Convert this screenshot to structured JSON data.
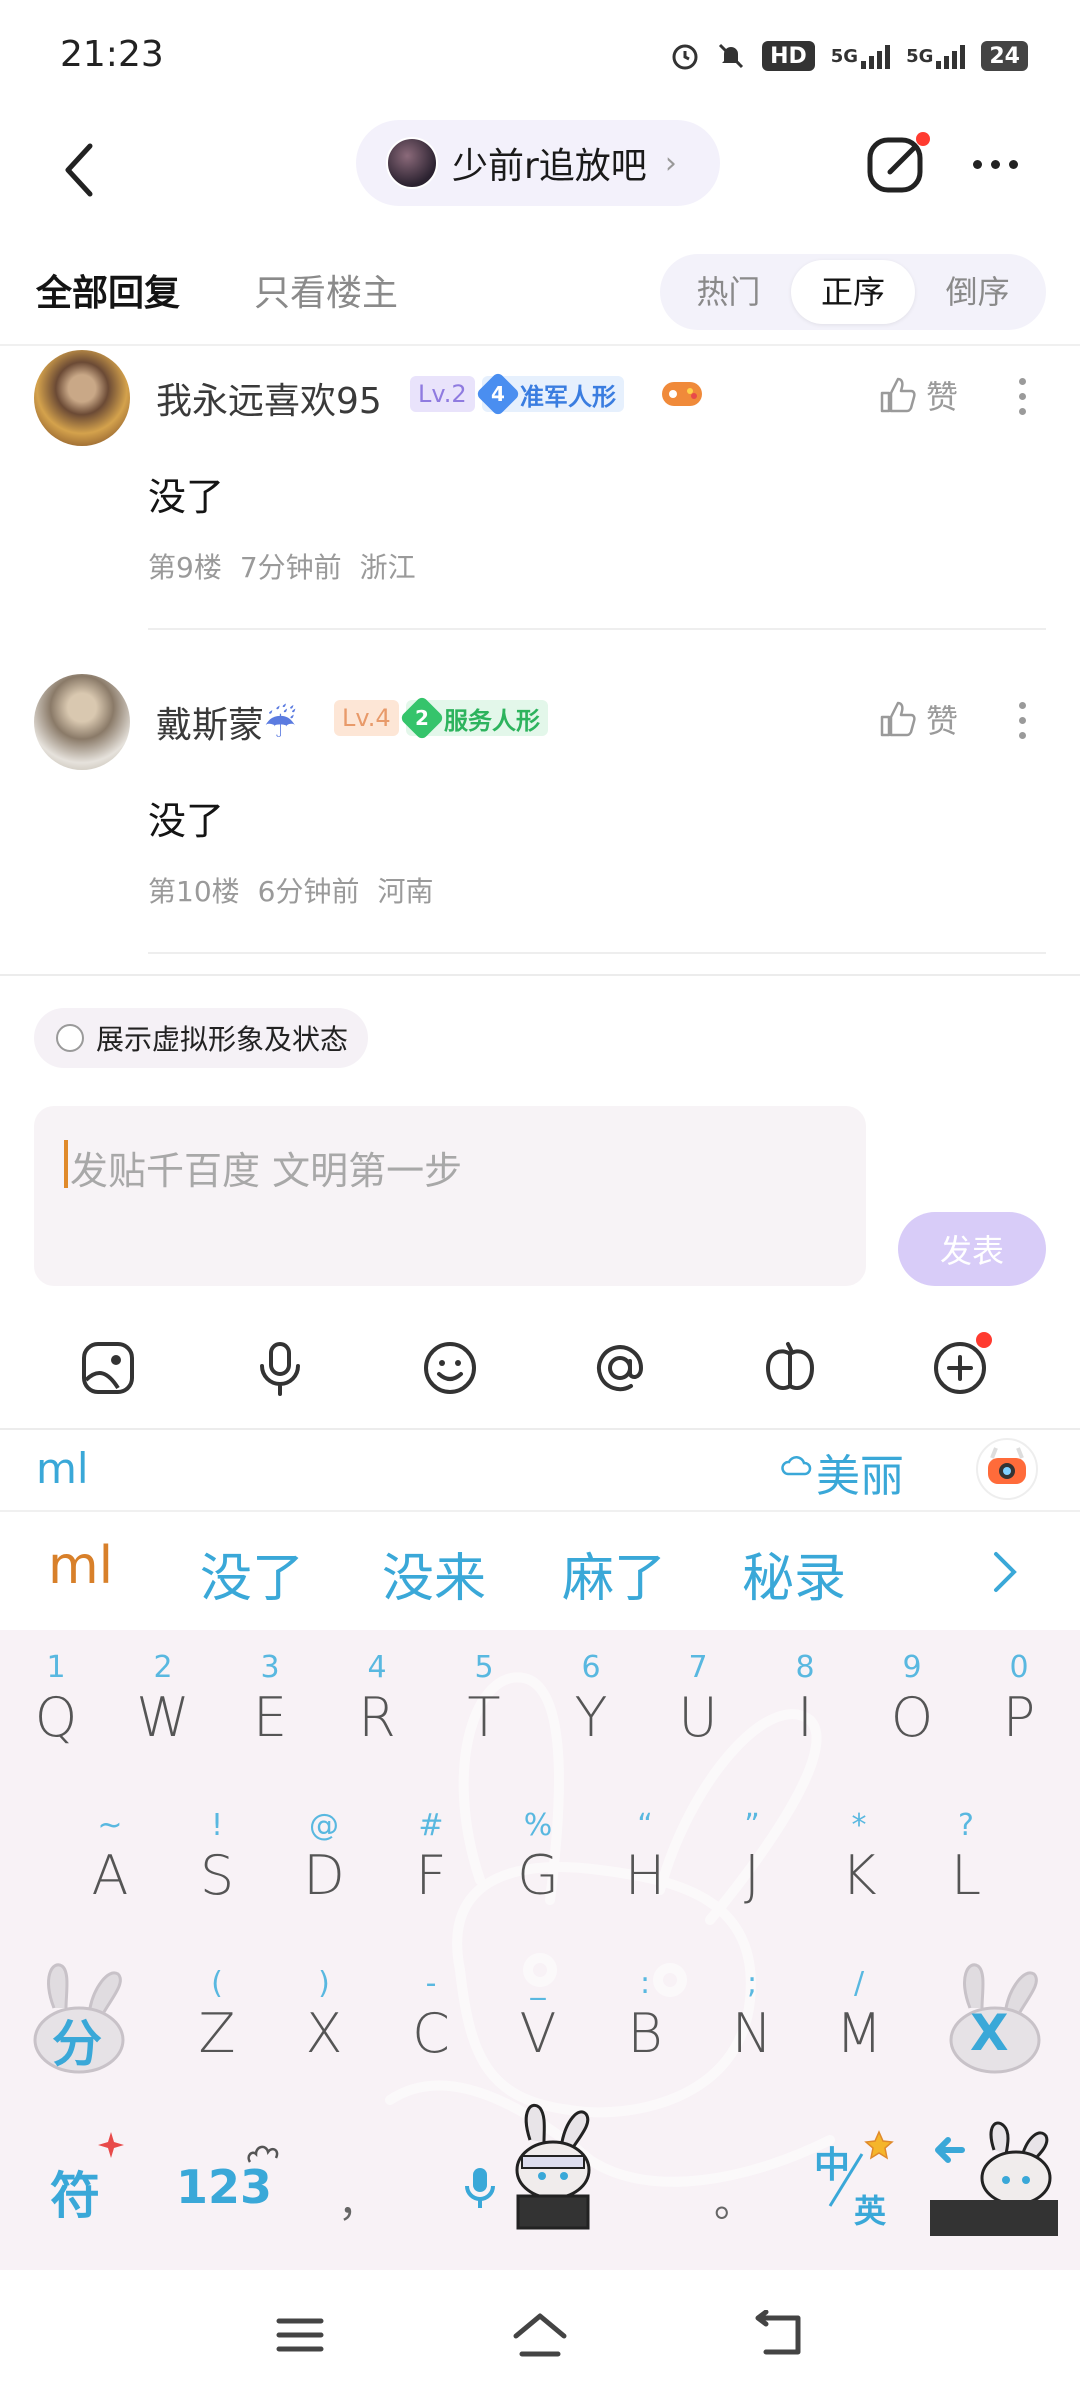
{
  "status_bar": {
    "time": "21:23",
    "hd_label": "HD",
    "net1": "5G",
    "net2": "5G",
    "battery": "24"
  },
  "nav": {
    "forum_name": "少前r追放吧"
  },
  "tabs": {
    "all": "全部回复",
    "owner_only": "只看楼主",
    "sort": [
      "热门",
      "正序",
      "倒序"
    ],
    "active_sort": "正序"
  },
  "replies": [
    {
      "username": "我永远喜欢95",
      "level": "Lv.2",
      "rank_num": "4",
      "rank_title": "准军人形",
      "content": "没了",
      "floor": "第9楼",
      "time": "7分钟前",
      "location": "浙江",
      "like_label": "赞"
    },
    {
      "username": "戴斯蒙",
      "level": "Lv.4",
      "rank_num": "2",
      "rank_title": "服务人形",
      "content": "没了",
      "floor": "第10楼",
      "time": "6分钟前",
      "location": "河南",
      "like_label": "赞"
    }
  ],
  "composer": {
    "avatar_toggle": "展示虚拟形象及状态",
    "placeholder": "发贴千百度 文明第一步",
    "submit": "发表"
  },
  "keyboard": {
    "pinyin": "ml",
    "cloud_word": "美丽",
    "candidates": [
      "ml",
      "没了",
      "没来",
      "麻了",
      "秘录"
    ],
    "row1": [
      {
        "hint": "1",
        "key": "Q"
      },
      {
        "hint": "2",
        "key": "W"
      },
      {
        "hint": "3",
        "key": "E"
      },
      {
        "hint": "4",
        "key": "R"
      },
      {
        "hint": "5",
        "key": "T"
      },
      {
        "hint": "6",
        "key": "Y"
      },
      {
        "hint": "7",
        "key": "U"
      },
      {
        "hint": "8",
        "key": "I"
      },
      {
        "hint": "9",
        "key": "O"
      },
      {
        "hint": "0",
        "key": "P"
      }
    ],
    "row2": [
      {
        "hint": "~",
        "key": "A"
      },
      {
        "hint": "!",
        "key": "S"
      },
      {
        "hint": "@",
        "key": "D"
      },
      {
        "hint": "#",
        "key": "F"
      },
      {
        "hint": "%",
        "key": "G"
      },
      {
        "hint": "“",
        "key": "H"
      },
      {
        "hint": "”",
        "key": "J"
      },
      {
        "hint": "*",
        "key": "K"
      },
      {
        "hint": "?",
        "key": "L"
      }
    ],
    "row3": [
      {
        "hint": "(",
        "key": "Z"
      },
      {
        "hint": ")",
        "key": "X"
      },
      {
        "hint": "-",
        "key": "C"
      },
      {
        "hint": "_",
        "key": "V"
      },
      {
        "hint": ":",
        "key": "B"
      },
      {
        "hint": ";",
        "key": "N"
      },
      {
        "hint": "/",
        "key": "M"
      }
    ],
    "fen": "分",
    "delete": "X",
    "fu": "符",
    "num": "123",
    "comma": "，",
    "period": "。",
    "zh": "中",
    "en": "英"
  },
  "colors": {
    "accent": "#3aa8d8",
    "submit_disabled": "#d8ccf8",
    "badge_red": "#ff3b30"
  }
}
